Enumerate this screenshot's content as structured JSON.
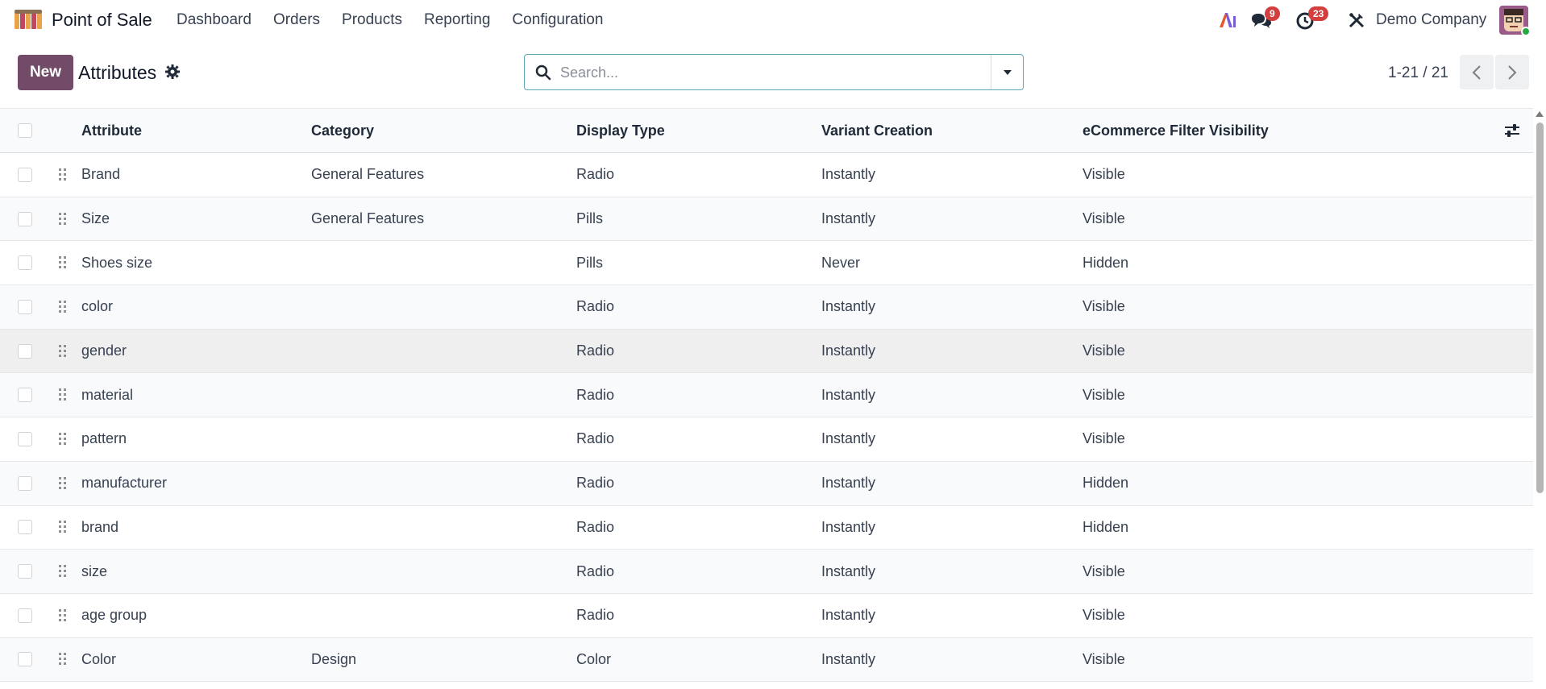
{
  "navbar": {
    "app_name": "Point of Sale",
    "menu": [
      "Dashboard",
      "Orders",
      "Products",
      "Reporting",
      "Configuration"
    ],
    "messages_count": "9",
    "activities_count": "23",
    "company": "Demo Company"
  },
  "control_panel": {
    "new_label": "New",
    "title": "Attributes",
    "search_placeholder": "Search...",
    "pager": "1-21 / 21"
  },
  "table": {
    "columns": [
      "Attribute",
      "Category",
      "Display Type",
      "Variant Creation",
      "eCommerce Filter Visibility"
    ],
    "rows": [
      {
        "attribute": "Brand",
        "category": "General Features",
        "display_type": "Radio",
        "variant_creation": "Instantly",
        "visibility": "Visible"
      },
      {
        "attribute": "Size",
        "category": "General Features",
        "display_type": "Pills",
        "variant_creation": "Instantly",
        "visibility": "Visible"
      },
      {
        "attribute": "Shoes size",
        "category": "",
        "display_type": "Pills",
        "variant_creation": "Never",
        "visibility": "Hidden"
      },
      {
        "attribute": "color",
        "category": "",
        "display_type": "Radio",
        "variant_creation": "Instantly",
        "visibility": "Visible"
      },
      {
        "attribute": "gender",
        "category": "",
        "display_type": "Radio",
        "variant_creation": "Instantly",
        "visibility": "Visible"
      },
      {
        "attribute": "material",
        "category": "",
        "display_type": "Radio",
        "variant_creation": "Instantly",
        "visibility": "Visible"
      },
      {
        "attribute": "pattern",
        "category": "",
        "display_type": "Radio",
        "variant_creation": "Instantly",
        "visibility": "Visible"
      },
      {
        "attribute": "manufacturer",
        "category": "",
        "display_type": "Radio",
        "variant_creation": "Instantly",
        "visibility": "Hidden"
      },
      {
        "attribute": "brand",
        "category": "",
        "display_type": "Radio",
        "variant_creation": "Instantly",
        "visibility": "Hidden"
      },
      {
        "attribute": "size",
        "category": "",
        "display_type": "Radio",
        "variant_creation": "Instantly",
        "visibility": "Visible"
      },
      {
        "attribute": "age group",
        "category": "",
        "display_type": "Radio",
        "variant_creation": "Instantly",
        "visibility": "Visible"
      },
      {
        "attribute": "Color",
        "category": "Design",
        "display_type": "Color",
        "variant_creation": "Instantly",
        "visibility": "Visible"
      }
    ]
  },
  "colors": {
    "primary": "#714b67",
    "badge": "#d33e3e",
    "search_border": "#5ea6b3"
  },
  "icons": [
    "pos-logo-icon",
    "ai-icon",
    "chat-icon",
    "clock-icon",
    "tools-icon",
    "avatar",
    "gear-icon",
    "search-icon",
    "caret-down-icon",
    "chevron-left-icon",
    "chevron-right-icon",
    "drag-handle-icon",
    "optional-columns-icon"
  ]
}
